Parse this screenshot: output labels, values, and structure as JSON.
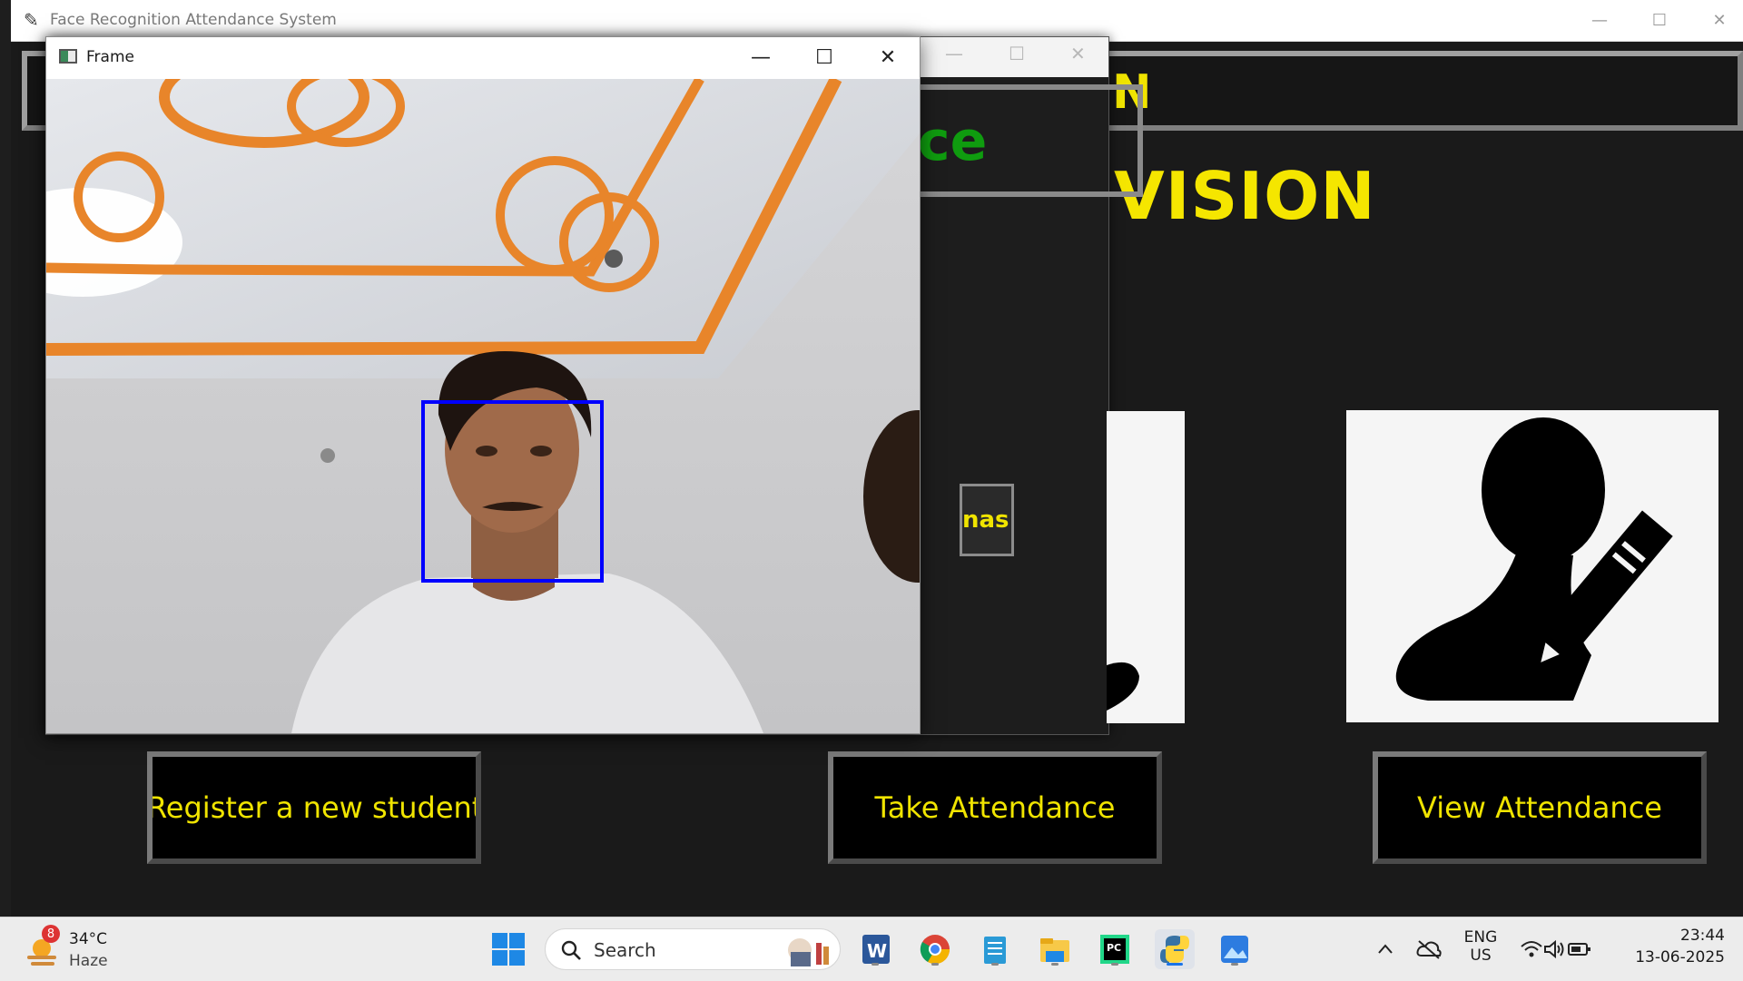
{
  "main_window": {
    "title": "Face Recognition Attendance System",
    "banner_partial": "N",
    "heading_partial": "VISION",
    "buttons": {
      "register": "Register a new student",
      "take": "Take Attendance",
      "view": "View Attendance"
    }
  },
  "second_window": {
    "green_partial": "ce",
    "small_button_partial": "nas"
  },
  "frame_window": {
    "title": "Frame"
  },
  "taskbar": {
    "weather": {
      "badge": "8",
      "temp": "34°C",
      "condition": "Haze"
    },
    "search_placeholder": "Search",
    "lang_top": "ENG",
    "lang_bottom": "US",
    "time": "23:44",
    "date": "13-06-2025"
  },
  "colors": {
    "heading_yellow": "#f5e600",
    "green_text": "#0f9c0f",
    "face_box": "#0000ff",
    "ceiling_orange": "#e8852a"
  }
}
